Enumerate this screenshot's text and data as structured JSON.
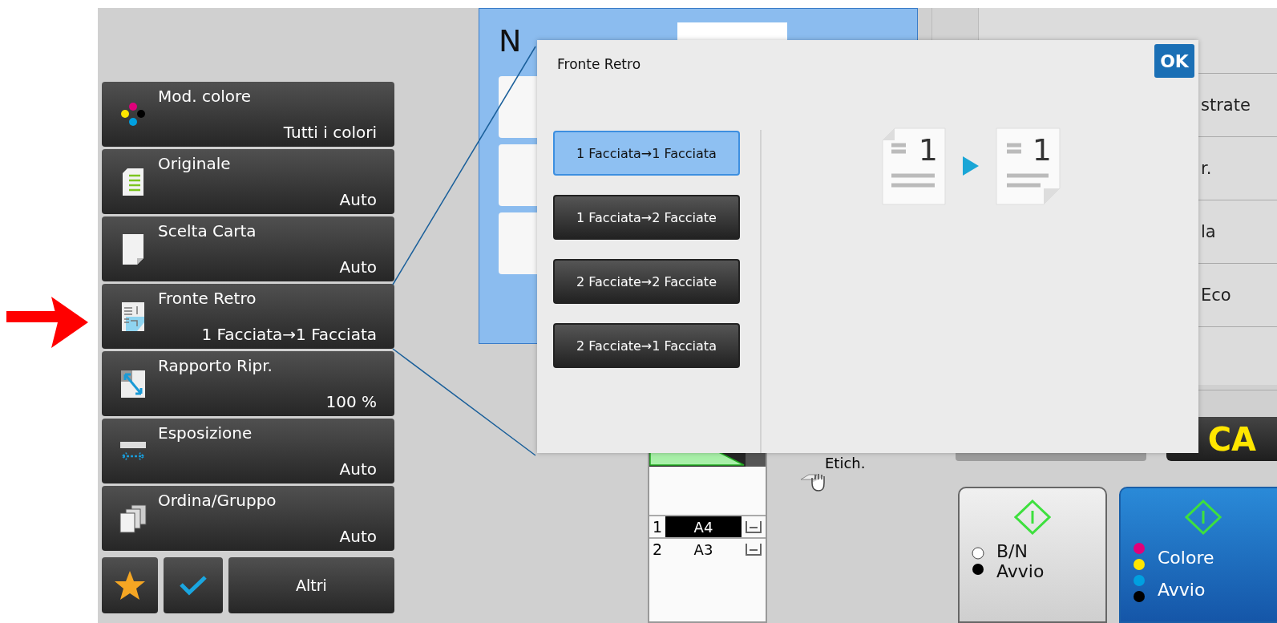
{
  "settings": [
    {
      "kind": "color",
      "label": "Mod. colore",
      "value": "Tutti i colori"
    },
    {
      "kind": "original",
      "label": "Originale",
      "value": "Auto"
    },
    {
      "kind": "paper",
      "label": "Scelta Carta",
      "value": "Auto"
    },
    {
      "kind": "duplex",
      "label": "Fronte Retro",
      "value": "1 Facciata→1 Facciata"
    },
    {
      "kind": "ratio",
      "label": "Rapporto Ripr.",
      "value": "100 %"
    },
    {
      "kind": "exposure",
      "label": "Esposizione",
      "value": "Auto"
    },
    {
      "kind": "sort",
      "label": "Ordina/Gruppo",
      "value": "Auto"
    }
  ],
  "bottom_buttons": [
    {
      "kind": "star"
    },
    {
      "kind": "check"
    },
    {
      "kind": "text",
      "label": "Altri"
    }
  ],
  "copies": {
    "label": "N"
  },
  "tray": {
    "label": "Etich.",
    "drawers": [
      {
        "number": "1",
        "size": "A4",
        "selected": true
      },
      {
        "number": "2",
        "size": "A3",
        "selected": false
      }
    ]
  },
  "right_panel": {
    "rows": [
      {
        "text": "strate"
      },
      {
        "text": "r."
      },
      {
        "text": "la"
      },
      {
        "text": "Eco"
      }
    ]
  },
  "clear_button": {
    "label": "CA"
  },
  "start_buttons": [
    {
      "kind": "bw",
      "label": "B/N",
      "sublabel": "Avvio",
      "selected": false
    },
    {
      "kind": "color",
      "label": "Colore",
      "sublabel": "Avvio",
      "selected": true
    }
  ],
  "dialog": {
    "title": "Fronte Retro",
    "ok": "OK",
    "options": [
      {
        "label": "1 Facciata→1 Facciata",
        "selected": true
      },
      {
        "label": "1 Facciata→2 Facciate",
        "selected": false
      },
      {
        "label": "2 Facciate→2 Facciate",
        "selected": false
      },
      {
        "label": "2 Facciate→1 Facciata",
        "selected": false
      }
    ],
    "preview": {
      "from": "1",
      "to": "1"
    }
  }
}
